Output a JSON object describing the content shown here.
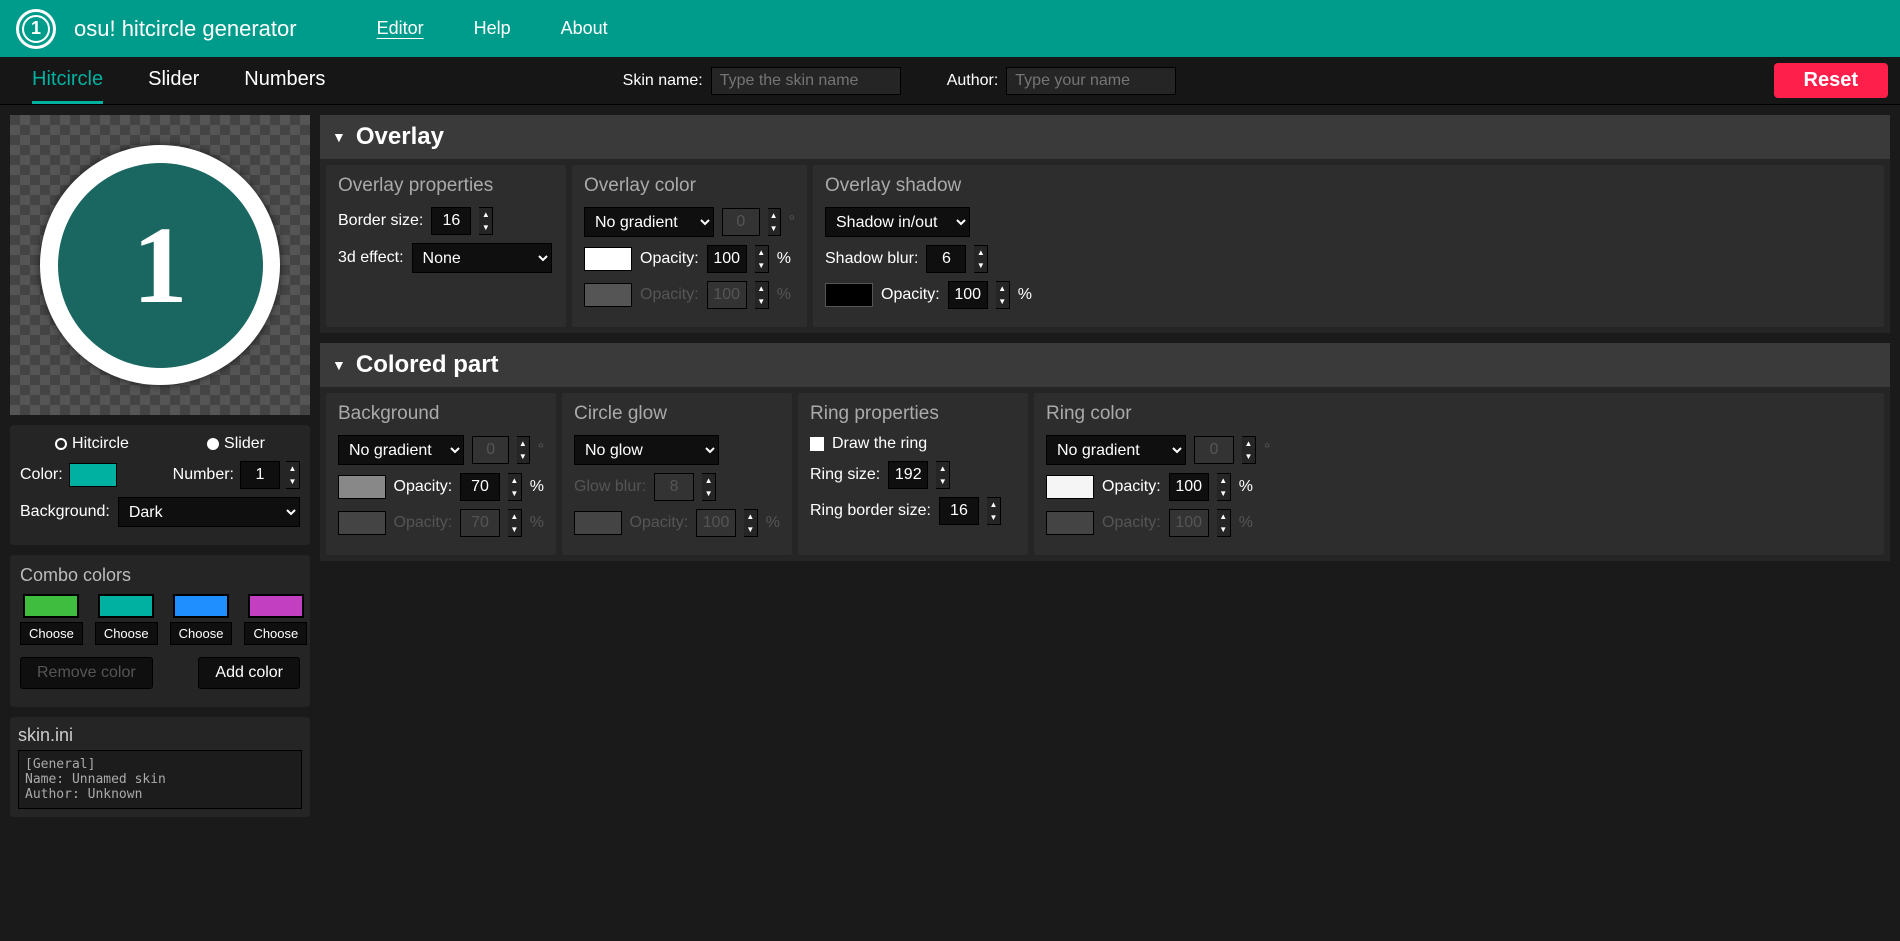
{
  "header": {
    "app_title": "osu! hitcircle generator",
    "logo_num": "1",
    "nav": {
      "editor": "Editor",
      "help": "Help",
      "about": "About"
    }
  },
  "subbar": {
    "tabs": {
      "hitcircle": "Hitcircle",
      "slider": "Slider",
      "numbers": "Numbers"
    },
    "skin_label": "Skin name:",
    "skin_ph": "Type the skin name",
    "author_label": "Author:",
    "author_ph": "Type your name",
    "reset": "Reset"
  },
  "preview": {
    "number": "1"
  },
  "left_controls": {
    "radio_hitcircle": "Hitcircle",
    "radio_slider": "Slider",
    "color_label": "Color:",
    "color_swatch": "#00b0a0",
    "number_label": "Number:",
    "number_value": "1",
    "bg_label": "Background:",
    "bg_value": "Dark"
  },
  "combo": {
    "title": "Combo colors",
    "items": [
      {
        "color": "#3fbd3f",
        "btn": "Choose"
      },
      {
        "color": "#00b0a0",
        "btn": "Choose"
      },
      {
        "color": "#1f8fff",
        "btn": "Choose"
      },
      {
        "color": "#c23fc2",
        "btn": "Choose"
      }
    ],
    "remove": "Remove color",
    "add": "Add color"
  },
  "skinini": {
    "title": "skin.ini",
    "content": "[General]\nName: Unnamed skin\nAuthor: Unknown"
  },
  "overlay": {
    "header": "Overlay",
    "props": {
      "title": "Overlay properties",
      "border_label": "Border size:",
      "border_value": "16",
      "effect_label": "3d effect:",
      "effect_value": "None"
    },
    "color": {
      "title": "Overlay color",
      "gradient": "No gradient",
      "angle": "0",
      "angle_deg": "°",
      "opacity_label": "Opacity:",
      "opacity_value": "100",
      "pct": "%",
      "swatch1": "#ffffff",
      "swatch2": "#555",
      "opacity2_label": "Opacity:",
      "opacity2_value": "100"
    },
    "shadow": {
      "title": "Overlay shadow",
      "mode": "Shadow in/out",
      "blur_label": "Shadow blur:",
      "blur_value": "6",
      "swatch": "#000000",
      "opacity_label": "Opacity:",
      "opacity_value": "100",
      "pct": "%"
    }
  },
  "colored": {
    "header": "Colored part",
    "bg": {
      "title": "Background",
      "gradient": "No gradient",
      "angle": "0",
      "swatch1": "#888",
      "op1_label": "Opacity:",
      "op1_value": "70",
      "pct": "%",
      "swatch2": "#444",
      "op2_label": "Opacity:",
      "op2_value": "70"
    },
    "glow": {
      "title": "Circle glow",
      "mode": "No glow",
      "blur_label": "Glow blur:",
      "blur_value": "8",
      "swatch": "#444",
      "op_label": "Opacity:",
      "op_value": "100",
      "pct": "%"
    },
    "ring": {
      "title": "Ring properties",
      "draw_label": "Draw the ring",
      "size_label": "Ring size:",
      "size_value": "192",
      "border_label": "Ring border size:",
      "border_value": "16"
    },
    "ringcolor": {
      "title": "Ring color",
      "gradient": "No gradient",
      "angle": "0",
      "swatch1": "#f5f5f5",
      "op1_label": "Opacity:",
      "op1_value": "100",
      "pct": "%",
      "swatch2": "#444",
      "op2_label": "Opacity:",
      "op2_value": "100"
    }
  }
}
